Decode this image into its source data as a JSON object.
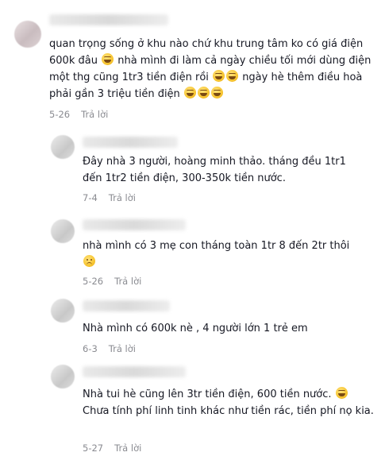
{
  "comments": [
    {
      "text": "quan trọng sống ở khu nào chứ khu trung tâm ko có giá điện 600k đâu",
      "text_b": " nhà mình đi làm cả ngày chiều tối mới dùng điện một thg cũng 1tr3 tiền điện rồi",
      "text_c": " ngày hè thêm điều hoà phải gần 3 triệu tiền điện",
      "date": "5-26",
      "reply": "Trả lời"
    }
  ],
  "replies": [
    {
      "text": "Đây nhà 3 người, hoàng minh thảo. tháng đều 1tr1 đến 1tr2 tiền điện, 300-350k tiền nước.",
      "date": "7-4",
      "reply": "Trả lời"
    },
    {
      "text": "nhà mình có 3 mẹ con tháng toàn 1tr 8 đến 2tr thôi",
      "date": "5-26",
      "reply": "Trả lời"
    },
    {
      "text": "Nhà mình có 600k nè , 4 người lớn 1 trẻ em",
      "date": "6-3",
      "reply": "Trả lời"
    },
    {
      "text": "Nhà tui hè cũng lên 3tr tiền điện, 600 tiền nước.",
      "text_b": "Chưa tính phí linh tinh khác như tiền rác, tiền phí nọ kia.",
      "date": "5-27",
      "reply": "Trả lời"
    }
  ],
  "emoji": {
    "laugh": "laughing-face",
    "sad": "sad-face"
  }
}
